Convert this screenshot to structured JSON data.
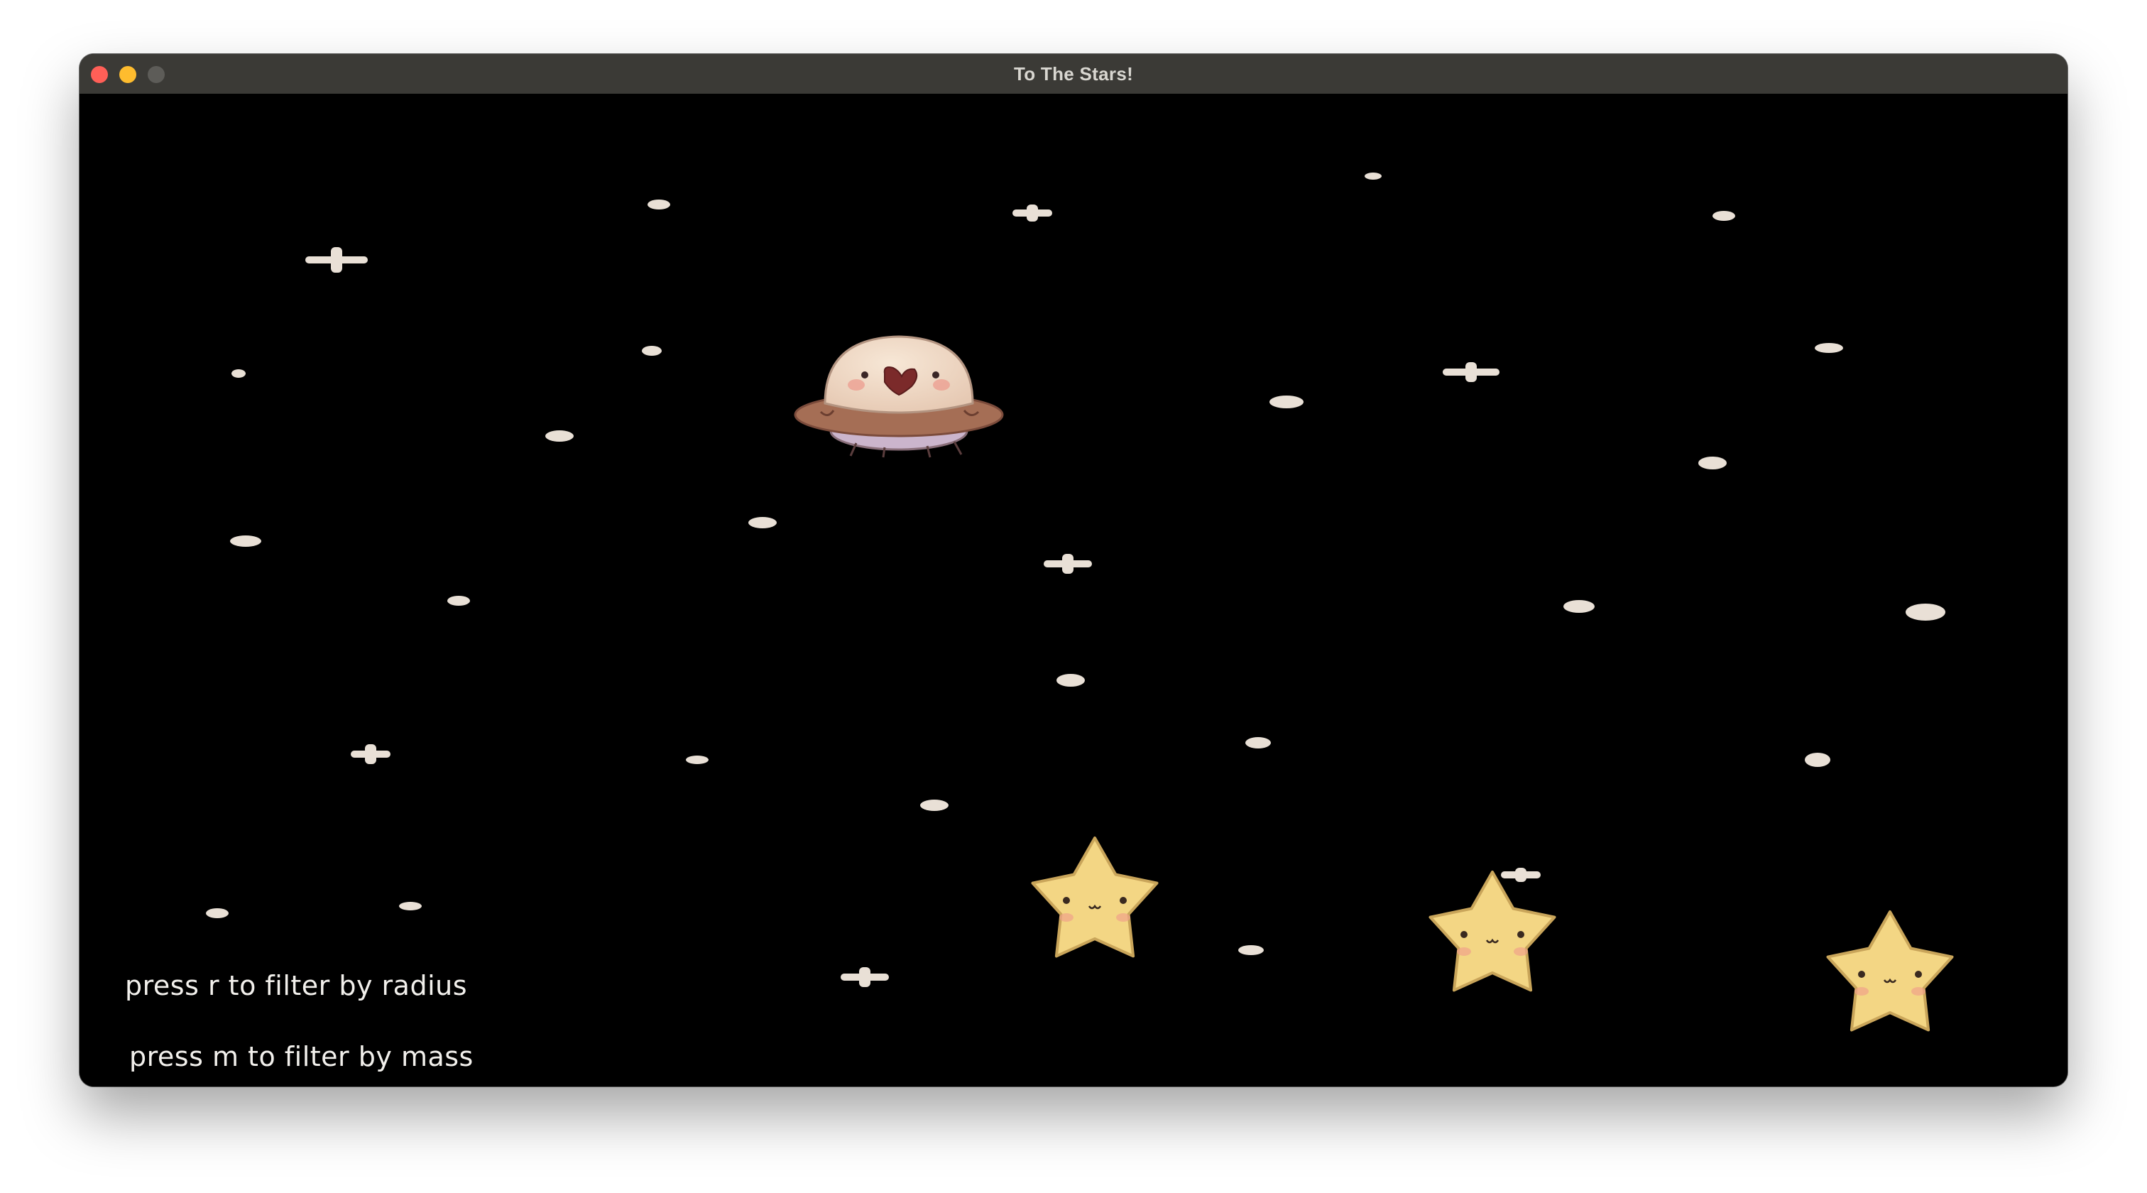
{
  "window": {
    "title": "To The Stars!",
    "traffic_lights": {
      "close_color": "#ff5f57",
      "minimize_color": "#febc2e",
      "maximize_color": "#5d5c58"
    }
  },
  "game": {
    "background_color": "#000000",
    "hints": [
      "press r to filter by radius",
      "press m to filter by mass"
    ],
    "sprites": {
      "player": "ufo-sprite",
      "targets": [
        "star-character",
        "star-character",
        "star-character"
      ],
      "background_stars": [
        "sparkle-star",
        "dot-star"
      ]
    },
    "colors": {
      "star_fill": "#f3d684",
      "star_outline": "#c9a55a",
      "sparkle": "#e9e0d6",
      "ufo_dome": "#efd9c6",
      "ufo_ring": "#a36f55",
      "ufo_base": "#c9b3c9"
    }
  }
}
